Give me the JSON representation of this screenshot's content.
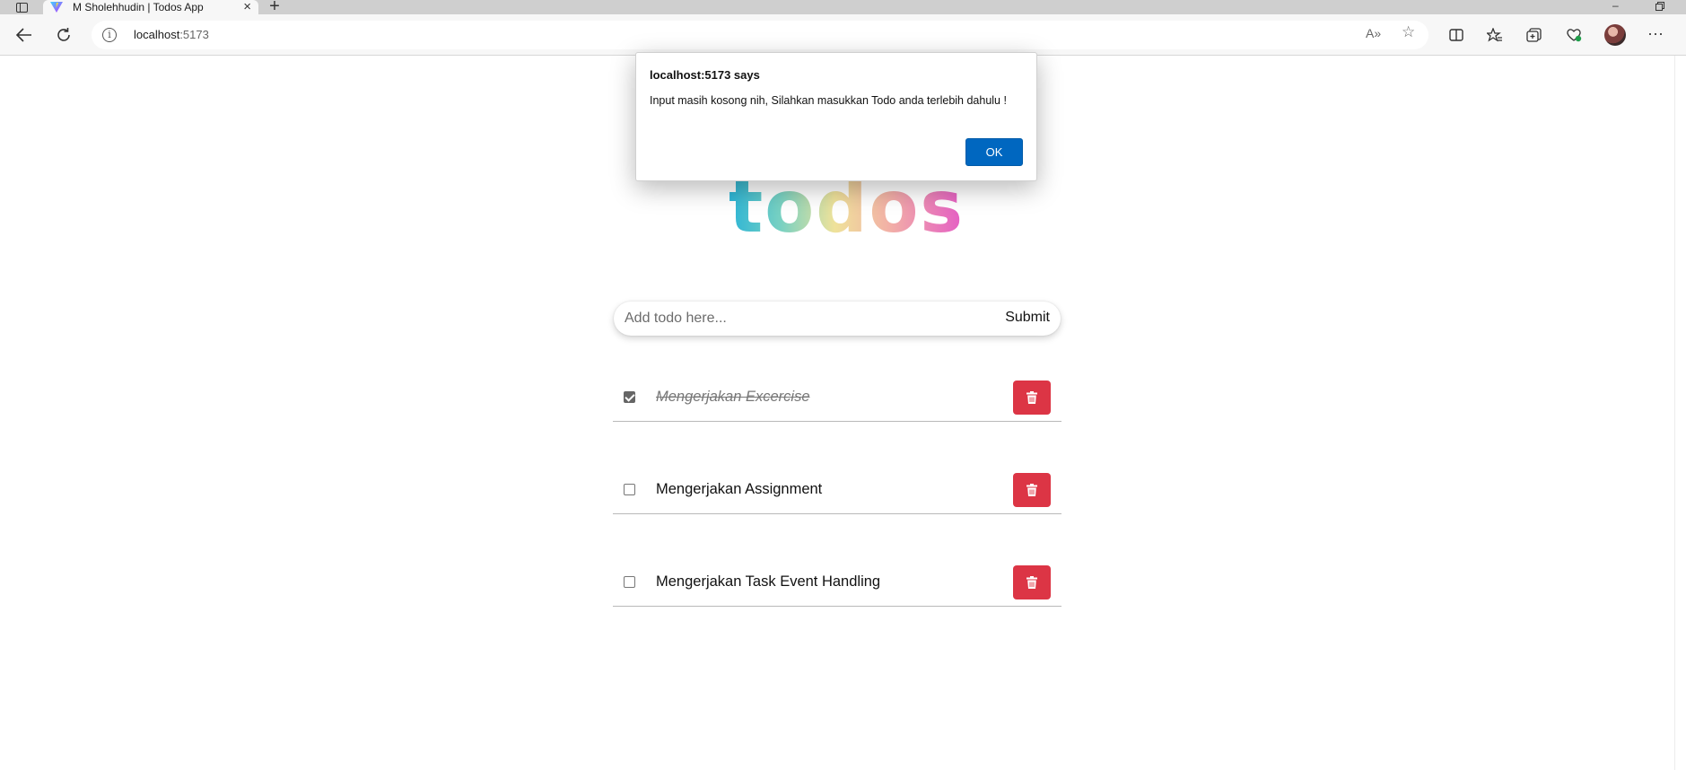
{
  "browser": {
    "tab_title": "M Sholehhudin | Todos App",
    "url_host": "localhost",
    "url_port": ":5173"
  },
  "dialog": {
    "title": "localhost:5173 says",
    "message": "Input masih kosong nih, Silahkan masukkan Todo anda terlebih dahulu !",
    "ok_label": "OK"
  },
  "app": {
    "logo_text": "todos",
    "input_placeholder": "Add todo here...",
    "input_value": "",
    "submit_label": "Submit",
    "todos": [
      {
        "text": "Mengerjakan Excercise",
        "completed": true
      },
      {
        "text": "Mengerjakan Assignment",
        "completed": false
      },
      {
        "text": "Mengerjakan Task Event Handling",
        "completed": false
      }
    ]
  },
  "colors": {
    "delete_button": "#dc3545",
    "dialog_ok": "#0067c0"
  }
}
